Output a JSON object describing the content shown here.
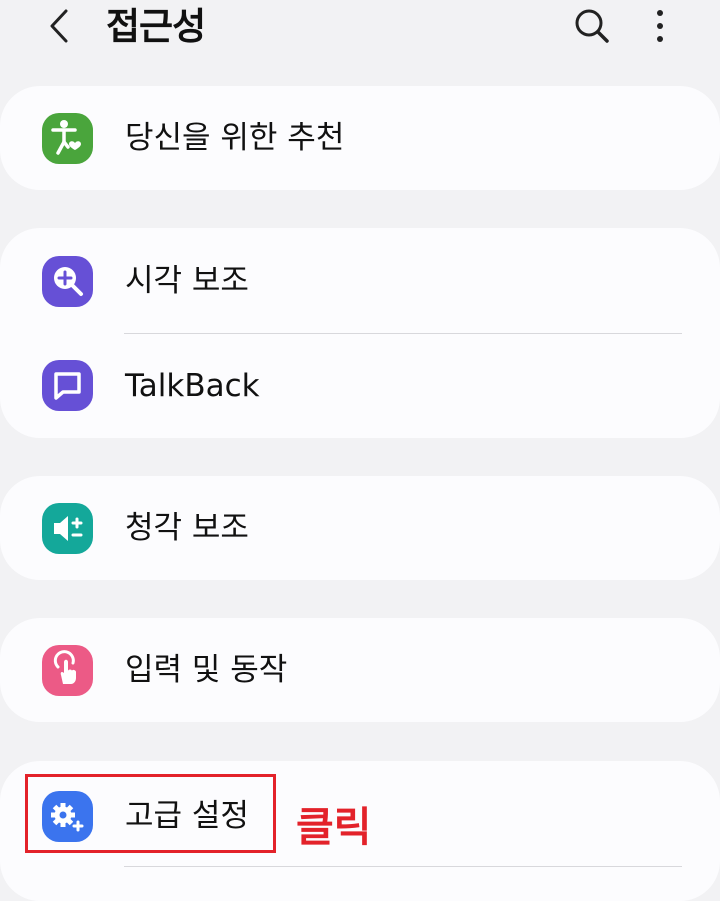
{
  "header": {
    "title": "접근성",
    "back_icon": "chevron-left-icon",
    "search_icon": "search-icon",
    "more_icon": "more-vertical-icon"
  },
  "items": [
    {
      "label": "당신을 위한 추천",
      "icon": "accessibility-person-icon",
      "icon_color": "#4aa53c"
    },
    {
      "label": "시각 보조",
      "icon": "magnifier-plus-icon",
      "icon_color": "#6650d6"
    },
    {
      "label": "TalkBack",
      "icon": "chat-bubble-icon",
      "icon_color": "#6650d6"
    },
    {
      "label": "청각 보조",
      "icon": "volume-plus-icon",
      "icon_color": "#14a89a"
    },
    {
      "label": "입력 및 동작",
      "icon": "touch-hand-icon",
      "icon_color": "#ec5a86"
    },
    {
      "label": "고급 설정",
      "icon": "gear-plus-icon",
      "icon_color": "#3b74ee"
    }
  ],
  "annotation": {
    "text": "클릭",
    "color": "#e3222a"
  }
}
